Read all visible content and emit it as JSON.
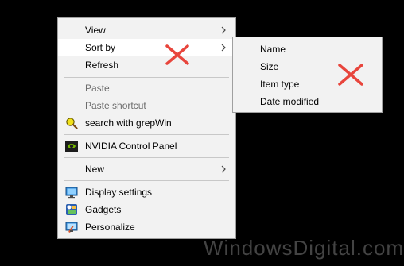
{
  "menu": {
    "view_label": "View",
    "sort_by_label": "Sort by",
    "refresh_label": "Refresh",
    "paste_label": "Paste",
    "paste_shortcut_label": "Paste shortcut",
    "grepwin_label": "search with grepWin",
    "nvidia_label": "NVIDIA Control Panel",
    "new_label": "New",
    "display_settings_label": "Display settings",
    "gadgets_label": "Gadgets",
    "personalize_label": "Personalize"
  },
  "submenu": {
    "name_label": "Name",
    "size_label": "Size",
    "item_type_label": "Item type",
    "date_modified_label": "Date modified"
  },
  "watermark": {
    "text": "WindowsDigital.com"
  },
  "colors": {
    "background": "#000000",
    "menu_bg": "#f2f2f2",
    "hover_bg": "#ffffff",
    "annotation_red": "#e8453c"
  },
  "icons": {
    "grepwin": "magnifier-icon",
    "nvidia": "nvidia-icon",
    "display_settings": "monitor-icon",
    "gadgets": "gadgets-icon",
    "personalize": "personalize-icon"
  }
}
